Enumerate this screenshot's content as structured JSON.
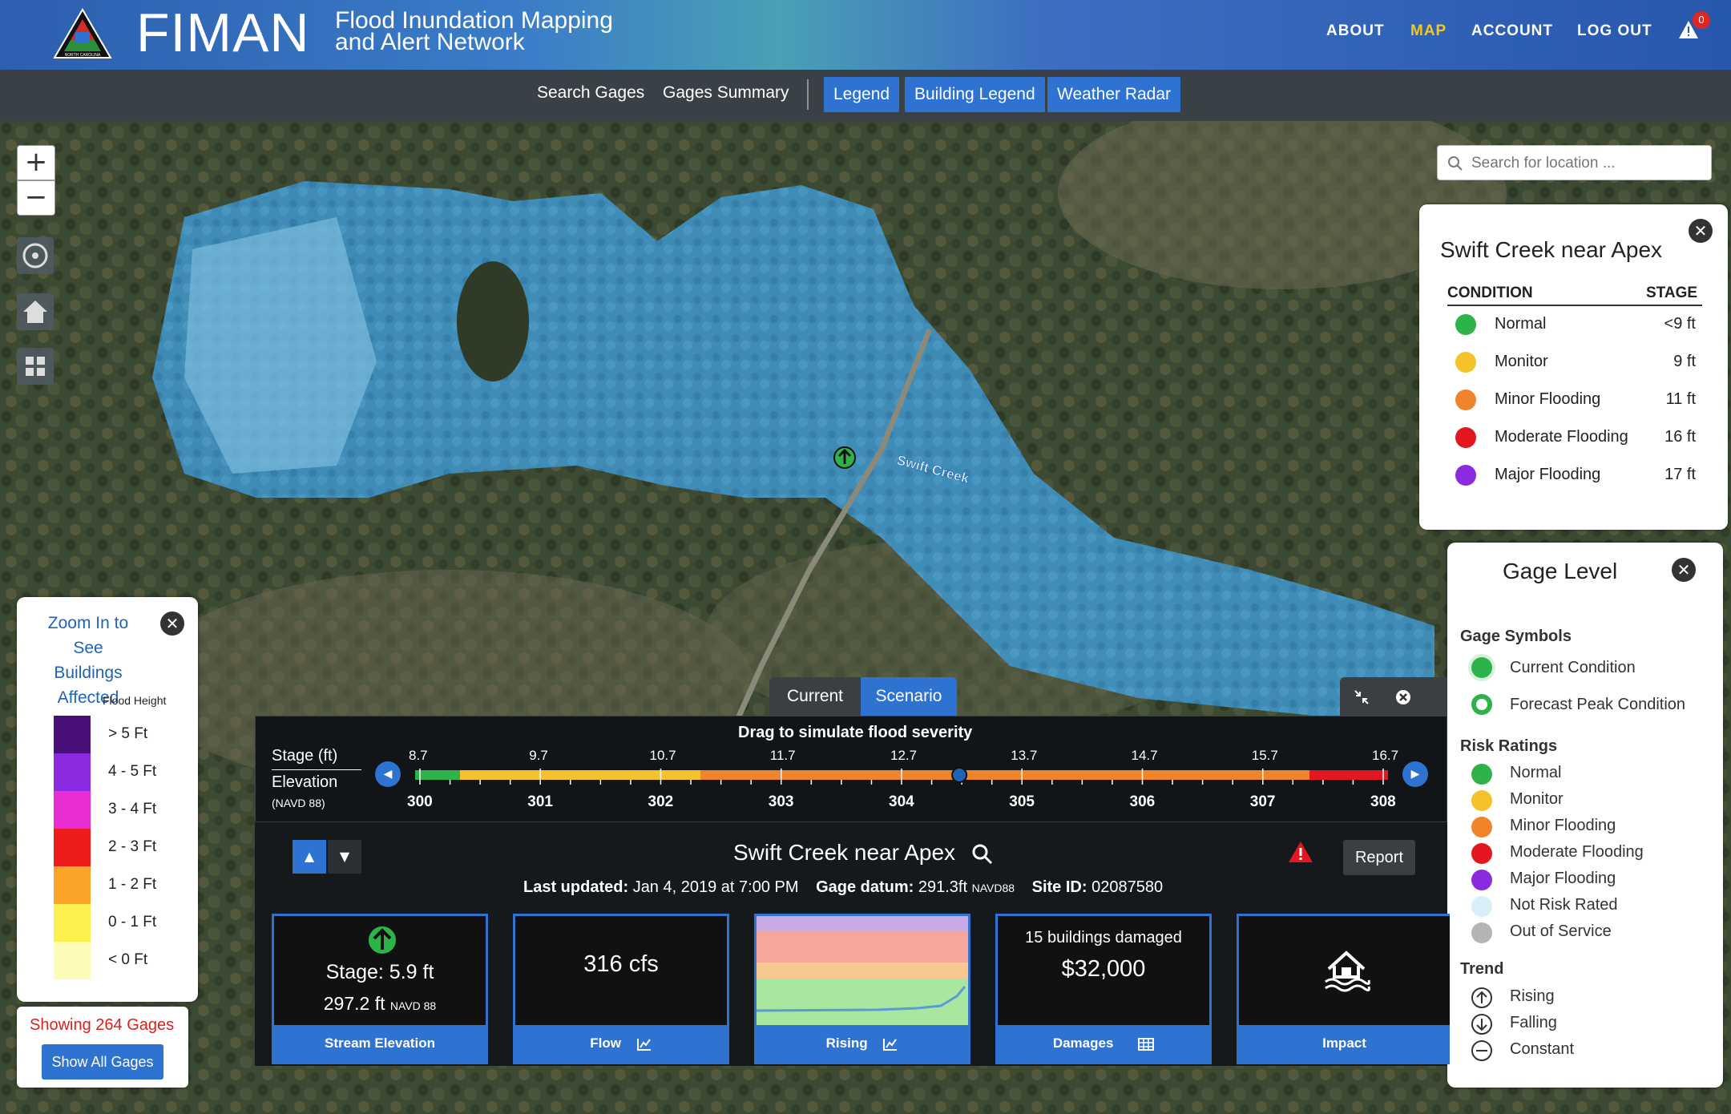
{
  "header": {
    "brand": "FIMAN",
    "subtitle_line1": "Flood Inundation Mapping",
    "subtitle_line2": "and Alert Network",
    "logo_text": "NORTH CAROLINA",
    "nav": [
      {
        "label": "ABOUT",
        "active": false
      },
      {
        "label": "MAP",
        "active": true
      },
      {
        "label": "ACCOUNT",
        "active": false
      },
      {
        "label": "LOG OUT",
        "active": false
      }
    ],
    "alert_count": "0"
  },
  "subnav": {
    "links": [
      "Search Gages",
      "Gages Summary"
    ],
    "buttons": [
      "Legend",
      "Building Legend",
      "Weather Radar"
    ]
  },
  "map": {
    "search_placeholder": "Search for location ...",
    "river_label": "Swift Creek",
    "zoom_in": "+",
    "zoom_out": "−"
  },
  "gage_popup": {
    "title": "Swift Creek near Apex",
    "col_condition": "CONDITION",
    "col_stage": "STAGE",
    "rows": [
      {
        "condition": "Normal",
        "stage": "<9 ft",
        "color": "#2db34a"
      },
      {
        "condition": "Monitor",
        "stage": "9 ft",
        "color": "#f5c22b"
      },
      {
        "condition": "Minor Flooding",
        "stage": "11 ft",
        "color": "#f0842a"
      },
      {
        "condition": "Moderate Flooding",
        "stage": "16 ft",
        "color": "#e3171f"
      },
      {
        "condition": "Major Flooding",
        "stage": "17 ft",
        "color": "#8a2be2"
      }
    ]
  },
  "gage_level": {
    "title": "Gage Level",
    "symbols_heading": "Gage Symbols",
    "symbols": [
      "Current Condition",
      "Forecast Peak Condition"
    ],
    "risk_heading": "Risk Ratings",
    "risks": [
      {
        "label": "Normal",
        "color": "#2db34a"
      },
      {
        "label": "Monitor",
        "color": "#f5c22b"
      },
      {
        "label": "Minor Flooding",
        "color": "#f0842a"
      },
      {
        "label": "Moderate Flooding",
        "color": "#e3171f"
      },
      {
        "label": "Major Flooding",
        "color": "#8a2be2"
      },
      {
        "label": "Not Risk Rated",
        "color": "#d8eef8"
      },
      {
        "label": "Out of Service",
        "color": "#b4b4b4"
      }
    ],
    "trend_heading": "Trend",
    "trends": [
      "Rising",
      "Falling",
      "Constant"
    ]
  },
  "flood_legend": {
    "zoom_text_line1": "Zoom In to",
    "zoom_text_line2": "See",
    "zoom_text_line3": "Buildings Affected",
    "title": "Flood Height",
    "items": [
      {
        "label": "> 5 Ft",
        "color": "#4b0f7a"
      },
      {
        "label": "4 - 5 Ft",
        "color": "#8a2be2"
      },
      {
        "label": "3 - 4 Ft",
        "color": "#e82dd4"
      },
      {
        "label": "2 - 3 Ft",
        "color": "#ef1c1c"
      },
      {
        "label": "1 - 2 Ft",
        "color": "#fca42a"
      },
      {
        "label": "0 - 1 Ft",
        "color": "#fdf150"
      },
      {
        "label": "< 0 Ft",
        "color": "#fdfbb8"
      }
    ],
    "showing": "Showing 264 Gages",
    "show_all": "Show All Gages"
  },
  "scenario": {
    "tabs": [
      {
        "label": "Current",
        "active": false
      },
      {
        "label": "Scenario",
        "active": true
      }
    ],
    "title": "Drag to simulate flood severity",
    "stage_label": "Stage (ft)",
    "elevation_label": "Elevation",
    "elevation_unit": "(NAVD 88)",
    "stage_ticks": [
      "8.7",
      "9.7",
      "10.7",
      "11.7",
      "12.7",
      "13.7",
      "14.7",
      "15.7",
      "16.7"
    ],
    "elev_ticks": [
      "300",
      "301",
      "302",
      "303",
      "304",
      "305",
      "306",
      "307",
      "308"
    ],
    "slider_value_fraction": 0.56
  },
  "info": {
    "title": "Swift Creek near Apex",
    "last_updated_label": "Last updated:",
    "last_updated": "Jan 4, 2019 at 7:00 PM",
    "datum_label": "Gage datum:",
    "datum": "291.3ft",
    "datum_unit": "NAVD88",
    "site_label": "Site ID:",
    "site_id": "02087580",
    "report": "Report",
    "cards": {
      "stage": "Stage: 5.9 ft",
      "elevation": "297.2 ft",
      "elevation_unit": "NAVD 88",
      "stage_footer": "Stream Elevation",
      "flow": "316 cfs",
      "flow_footer": "Flow",
      "trend_footer": "Rising",
      "damage_count": "15 buildings damaged",
      "damage_cost": "$32,000",
      "damage_footer": "Damages",
      "impact_footer": "Impact"
    }
  }
}
